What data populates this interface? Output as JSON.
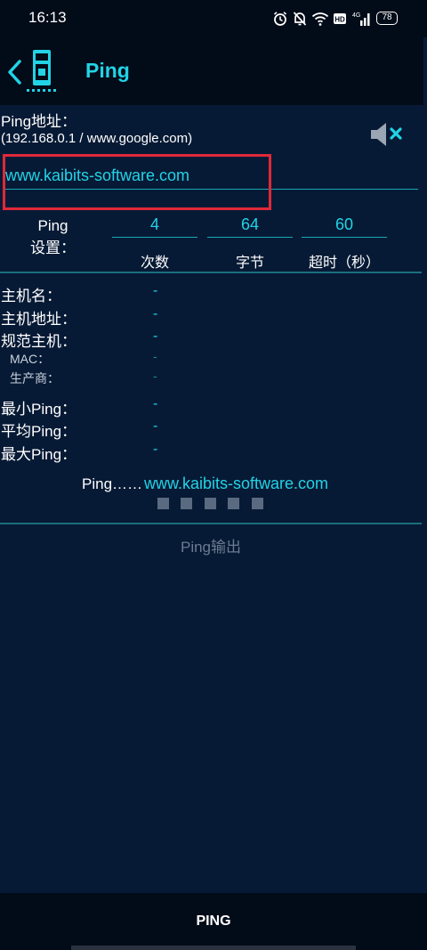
{
  "status_bar": {
    "time": "16:13",
    "battery": "78"
  },
  "app_bar": {
    "title": "Ping"
  },
  "address": {
    "label": "Ping地址：",
    "hint": "(192.168.0.1 / www.google.com)",
    "value": "www.kaibits-software.com"
  },
  "settings": {
    "label_line1": "Ping",
    "label_line2": "设置：",
    "count": "4",
    "bytes": "64",
    "timeout": "60",
    "count_caption": "次数",
    "bytes_caption": "字节",
    "timeout_caption": "超时（秒）"
  },
  "info": {
    "host_name_label": "主机名：",
    "host_address_label": "主机地址：",
    "canonical_host_label": "规范主机：",
    "mac_label": "MAC：",
    "vendor_label": "生产商：",
    "min_ping_label": "最小Ping：",
    "avg_ping_label": "平均Ping：",
    "max_ping_label": "最大Ping：",
    "empty_value": "-"
  },
  "ping_status": {
    "prefix": "Ping……",
    "host": "www.kaibits-software.com"
  },
  "output": {
    "label": "Ping输出"
  },
  "bottom": {
    "ping_button": "PING"
  },
  "colors": {
    "accent": "#22d3e6",
    "background": "#071a35",
    "highlight": "#e0293a"
  },
  "icons": [
    "back-icon",
    "app-logo-icon",
    "mute-icon",
    "alarm-icon",
    "bell-off-icon",
    "wifi-icon",
    "hd-icon",
    "signal-icon",
    "battery-icon"
  ]
}
